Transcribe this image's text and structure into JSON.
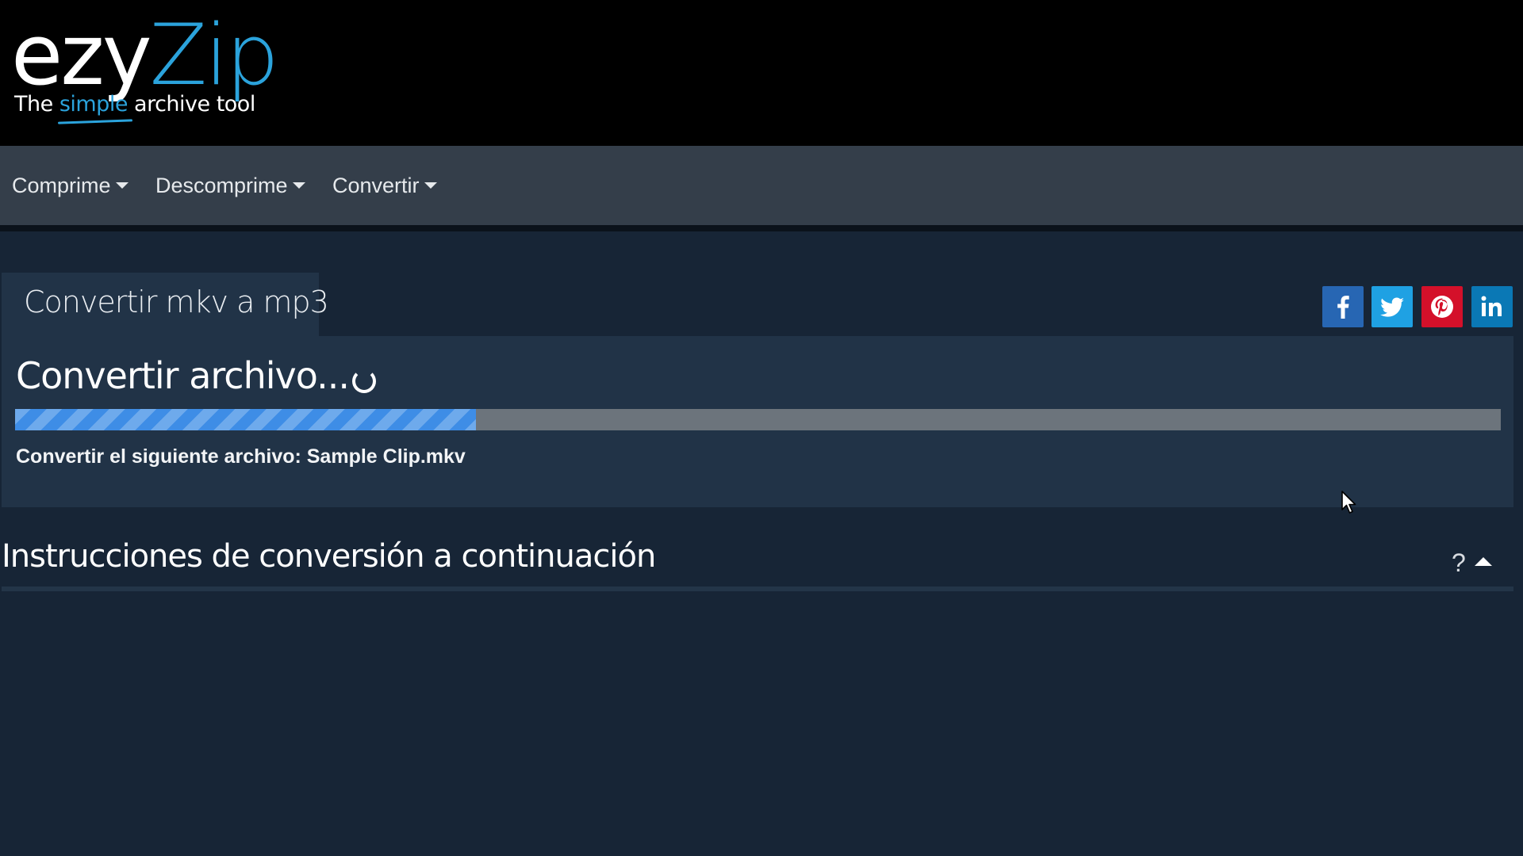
{
  "brand": {
    "logo_part1": "ezy",
    "logo_part2": "Zip",
    "tagline_before": "The ",
    "tagline_highlight": "simple",
    "tagline_after": " archive tool",
    "accent_color": "#2ba3dc"
  },
  "nav": {
    "items": [
      {
        "label": "Comprime"
      },
      {
        "label": "Descomprime"
      },
      {
        "label": "Convertir"
      }
    ]
  },
  "tab": {
    "label": "Convertir mkv a mp3"
  },
  "social": {
    "buttons": [
      {
        "name": "facebook",
        "icon": "facebook-icon",
        "color": "#2766b3"
      },
      {
        "name": "twitter",
        "icon": "twitter-icon",
        "color": "#1fa1e3"
      },
      {
        "name": "pinterest",
        "icon": "pinterest-icon",
        "color": "#d4102a"
      },
      {
        "name": "linkedin",
        "icon": "linkedin-icon",
        "color": "#0a78b5"
      }
    ]
  },
  "conversion": {
    "title": "Convertir archivo...",
    "spinner_icon": "loading-spinner-icon",
    "progress_percent": 31,
    "progress_color": "#3e8de6",
    "file_message": "Convertir el siguiente archivo: Sample Clip.mkv"
  },
  "instructions": {
    "title": "Instrucciones de conversión a continuación",
    "help_label": "?",
    "toggle_icon": "caret-up-icon"
  }
}
